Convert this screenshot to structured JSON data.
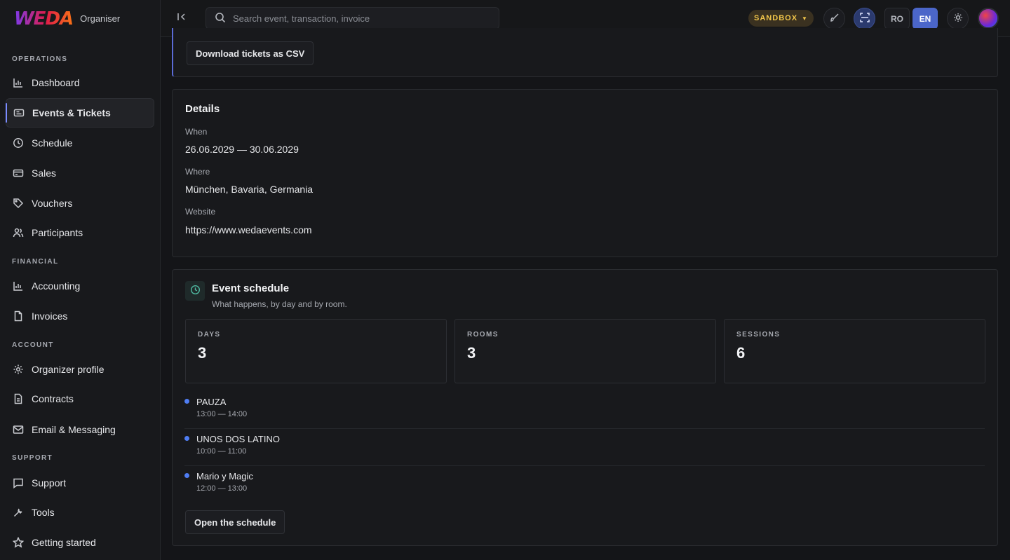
{
  "brand": {
    "logo": "WEDA",
    "subtitle": "Organiser"
  },
  "sidebar": {
    "sections": [
      {
        "label": "OPERATIONS"
      },
      {
        "label": "FINANCIAL"
      },
      {
        "label": "ACCOUNT"
      },
      {
        "label": "SUPPORT"
      }
    ],
    "items": [
      {
        "label": "Dashboard",
        "icon": "chart-icon"
      },
      {
        "label": "Events & Tickets",
        "icon": "ticket-icon",
        "active": true
      },
      {
        "label": "Schedule",
        "icon": "clock-icon"
      },
      {
        "label": "Sales",
        "icon": "card-icon"
      },
      {
        "label": "Vouchers",
        "icon": "tag-icon"
      },
      {
        "label": "Participants",
        "icon": "users-icon"
      },
      {
        "label": "Accounting",
        "icon": "chart-icon"
      },
      {
        "label": "Invoices",
        "icon": "file-icon"
      },
      {
        "label": "Organizer profile",
        "icon": "gear-icon"
      },
      {
        "label": "Contracts",
        "icon": "document-icon"
      },
      {
        "label": "Email & Messaging",
        "icon": "mail-icon"
      },
      {
        "label": "Support",
        "icon": "chat-icon"
      },
      {
        "label": "Tools",
        "icon": "wrench-icon"
      },
      {
        "label": "Getting started",
        "icon": "star-icon"
      }
    ]
  },
  "topbar": {
    "search_placeholder": "Search event, transaction, invoice",
    "env_badge": "SANDBOX",
    "lang_ro": "RO",
    "lang_en": "EN"
  },
  "tickets": {
    "download_label": "Download tickets as CSV"
  },
  "details": {
    "title": "Details",
    "when_label": "When",
    "when_value": "26.06.2029 — 30.06.2029",
    "where_label": "Where",
    "where_value": "München, Bavaria, Germania",
    "website_label": "Website",
    "website_value": "https://www.wedaevents.com"
  },
  "schedule": {
    "title": "Event schedule",
    "subtitle": "What happens, by day and by room.",
    "stats": [
      {
        "label": "DAYS",
        "value": "3"
      },
      {
        "label": "ROOMS",
        "value": "3"
      },
      {
        "label": "SESSIONS",
        "value": "6"
      }
    ],
    "sessions": [
      {
        "title": "PAUZA",
        "time": "13:00 — 14:00"
      },
      {
        "title": "UNOS DOS LATINO",
        "time": "10:00 — 11:00"
      },
      {
        "title": "Mario y Magic",
        "time": "12:00 — 13:00"
      }
    ],
    "open_label": "Open the schedule"
  },
  "colors": {
    "accent": "#4b66c9",
    "sandbox": "#f1c54a",
    "dot": "#4f7df3"
  }
}
